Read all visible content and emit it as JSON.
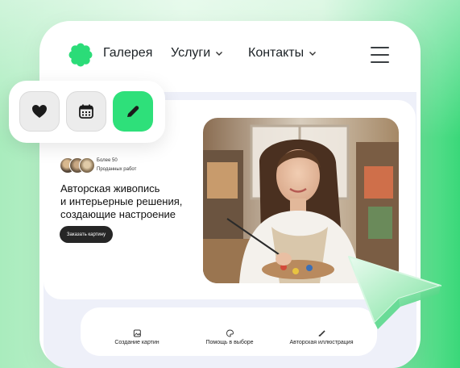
{
  "nav": {
    "items": [
      {
        "label": "Галерея"
      },
      {
        "label": "Услуги"
      },
      {
        "label": "Контакты"
      }
    ]
  },
  "hero": {
    "social_line1": "Более 50",
    "social_line2": "Проданных работ",
    "headline_lines": [
      "Авторская живопись",
      "и интерьерные решения,",
      "создающие настроение"
    ],
    "cta_label": "Заказать картину"
  },
  "services": [
    {
      "label": "Создание картин",
      "icon": "image-icon"
    },
    {
      "label": "Помощь в выборе",
      "icon": "palette-icon"
    },
    {
      "label": "Авторская иллюстрация",
      "icon": "brush-icon"
    }
  ],
  "toolbar": {
    "buttons": [
      {
        "icon": "heart-icon"
      },
      {
        "icon": "calendar-icon"
      },
      {
        "icon": "pen-icon",
        "active": true
      }
    ]
  },
  "colors": {
    "accent": "#2ee07a",
    "dark": "#262626"
  }
}
